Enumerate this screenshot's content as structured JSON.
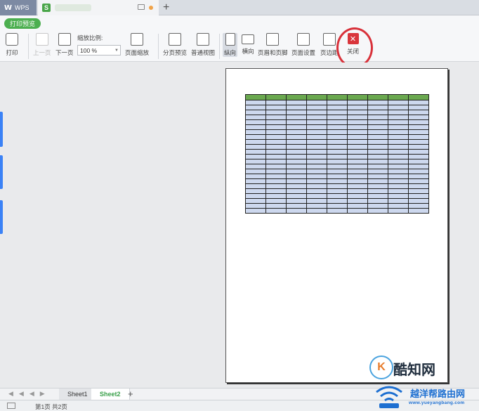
{
  "titlebar": {
    "app_tab": "WPS",
    "doc_tab_icon": "S"
  },
  "ribbon": {
    "mode_tab": "打印预览",
    "print": "打印",
    "prev_page": "上一页",
    "next_page": "下一页",
    "zoom_label": "缩放比例:",
    "zoom_value": "100 %",
    "page_zoom": "页面缩放",
    "page_break_preview": "分页预览",
    "normal_view": "普通视图",
    "portrait": "纵向",
    "landscape": "横向",
    "header_footer": "页眉和页脚",
    "page_setup": "页面设置",
    "margins": "页边距",
    "close": "关闭",
    "close_glyph": "✕"
  },
  "sheet_tabs": [
    "Sheet1",
    "Sheet2"
  ],
  "sheet_add": "+",
  "status": {
    "page_info": "第1页 共2页"
  },
  "watermark": {
    "logo_text": "酷知网",
    "logo_mark": "K",
    "site_cn": "越洋帮路由网",
    "site_url": "www.yueyangbang.com"
  },
  "colors": {
    "accent_green": "#4caf50",
    "close_red": "#d9353b",
    "table_header": "#6aa84f",
    "table_cell": "#cdd8ee"
  }
}
